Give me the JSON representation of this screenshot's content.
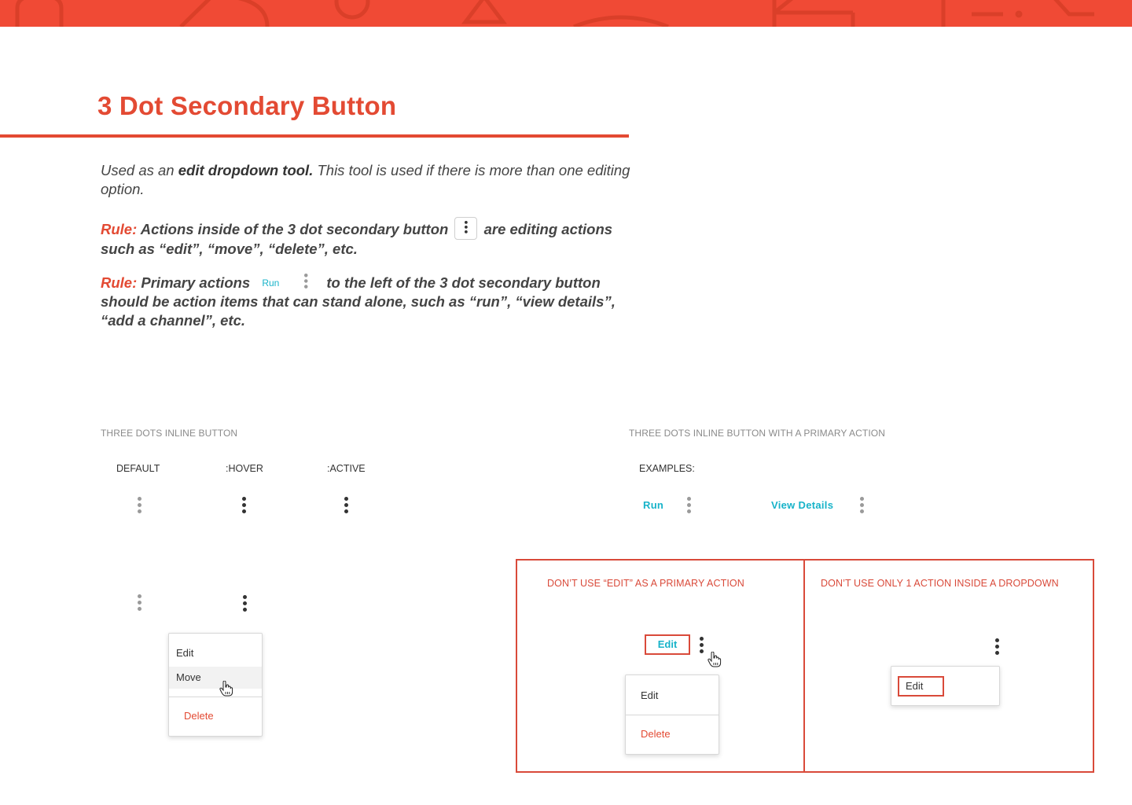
{
  "banner": {
    "color": "#f04a35"
  },
  "page": {
    "title": "3 Dot Secondary Button",
    "intro_a": "Used as an ",
    "intro_b": "edit dropdown tool.",
    "intro_c": " This tool is used if there is more than one editing option.",
    "rule_label": "Rule:",
    "rule1_a": " Actions inside of the 3 dot secondary button ",
    "rule1_b": " are editing actions such as “edit”, “move”, “delete”, etc.",
    "rule2_a": " Primary actions ",
    "rule2_run": "Run",
    "rule2_b": "to the left of the 3 dot secondary button should be action items that can stand alone, such as “run”, “view details”, “add a channel”, etc."
  },
  "inline_section": {
    "heading": "THREE DOTS INLINE BUTTON",
    "states": [
      "DEFAULT",
      ":HOVER",
      ":ACTIVE"
    ]
  },
  "primary_section": {
    "heading": "THREE DOTS INLINE BUTTON WITH A PRIMARY ACTION",
    "examples_label": "EXAMPLES:",
    "run_label": "Run",
    "view_details_label": "View Details"
  },
  "dropdown_menu": {
    "items": [
      "Edit",
      "Move"
    ],
    "danger_item": "Delete"
  },
  "dont_section": {
    "left_heading": "DON’T USE “EDIT” AS A PRIMARY ACTION",
    "right_heading": "DON’T USE ONLY 1 ACTION INSIDE A DROPDOWN",
    "edit_primary_label": "Edit",
    "left_menu_item": "Edit",
    "left_menu_danger": "Delete",
    "right_menu_item": "Edit"
  },
  "colors": {
    "accent": "#e34a33",
    "link": "#17b3c9",
    "muted": "#9a9a9a"
  },
  "icons": [
    "three-dots-icon",
    "hand-cursor-icon"
  ]
}
